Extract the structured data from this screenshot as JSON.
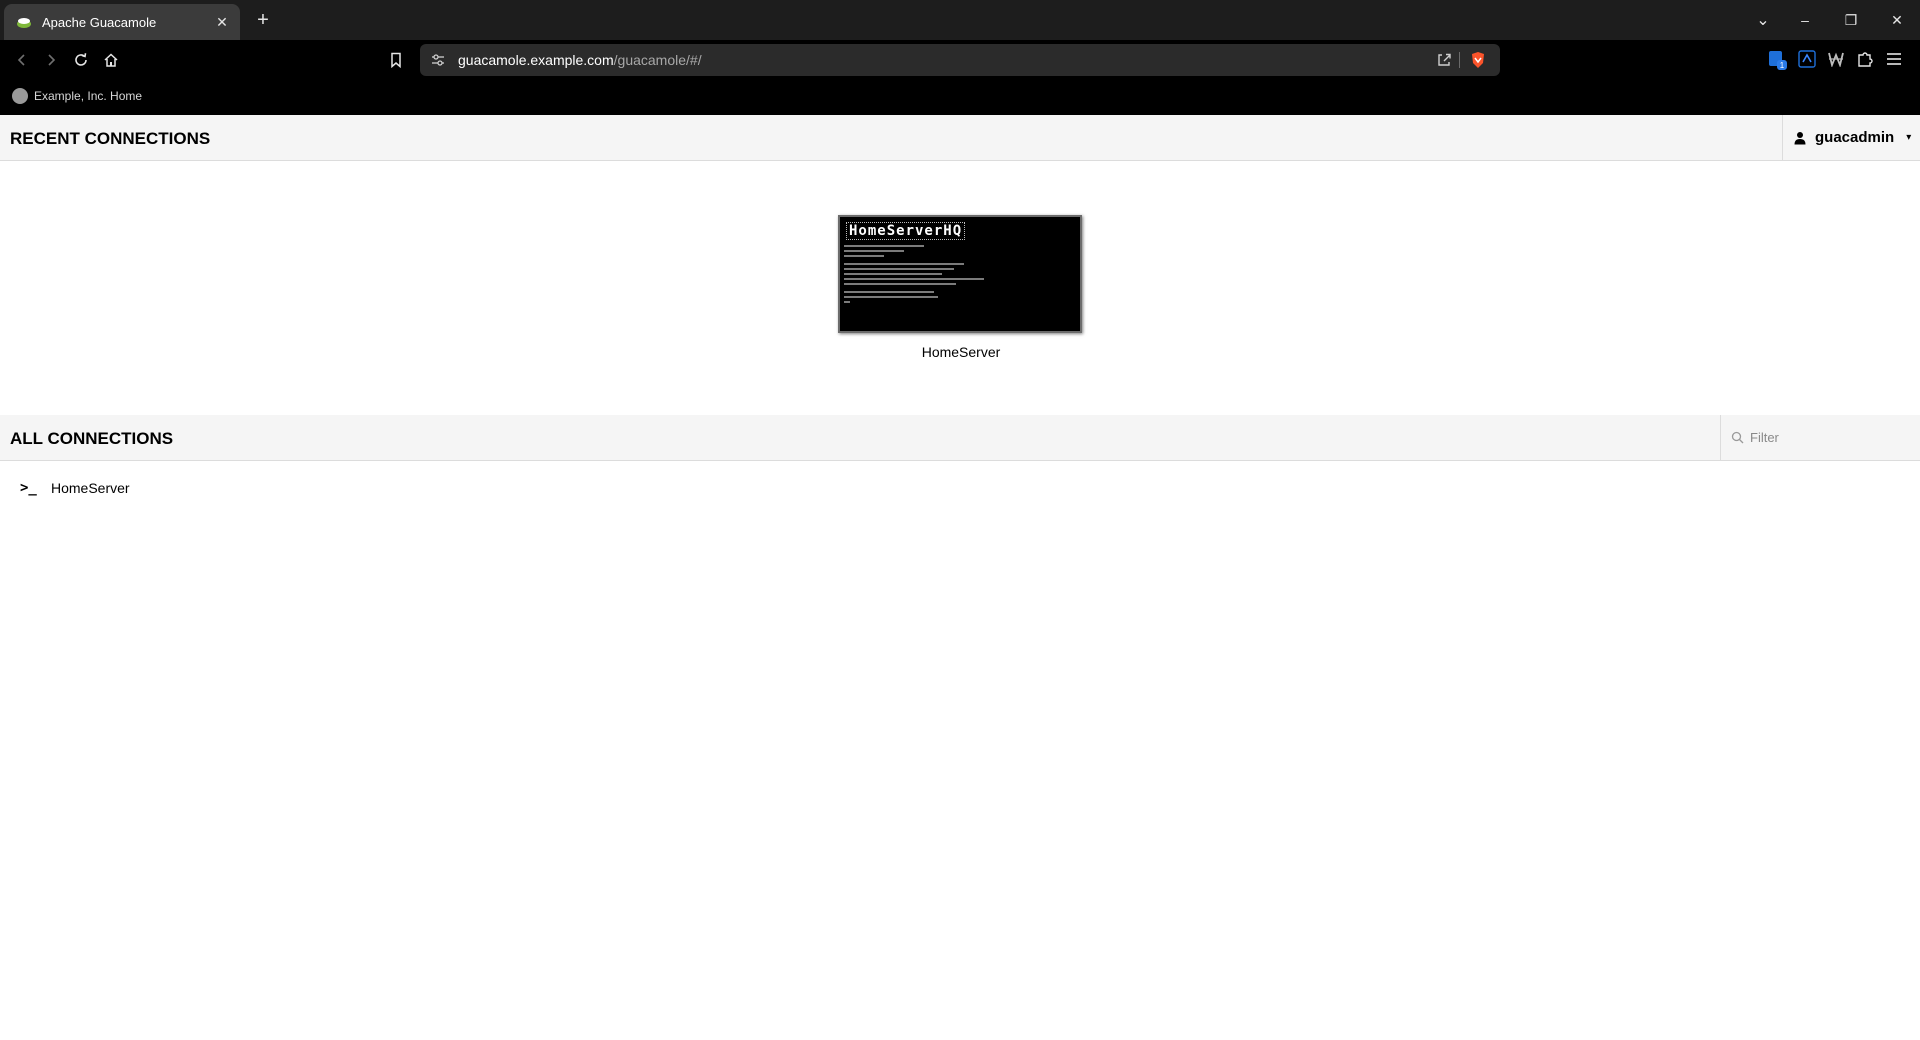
{
  "browser": {
    "tab": {
      "title": "Apache Guacamole"
    },
    "new_tab_symbol": "+",
    "window_controls": {
      "tab_search": "⌄",
      "minimize": "–",
      "restore": "❐",
      "close": "✕"
    },
    "address": {
      "host": "guacamole.example.com",
      "path": "/guacamole/#/"
    },
    "bookmarks": [
      {
        "label": "Example, Inc. Home"
      }
    ],
    "icons": {
      "back": "chevron-left-icon",
      "forward": "chevron-right-icon",
      "reload": "reload-icon",
      "home": "home-icon",
      "bookmark": "bookmark-icon",
      "site-info": "tune-icon",
      "share": "share-icon",
      "shields": "brave-shield-icon",
      "extensions": "puzzle-icon",
      "menu": "hamburger-menu-icon"
    },
    "colors": {
      "brave_orange": "#fb542b",
      "extension_blue": "#1e6fd9"
    }
  },
  "app": {
    "recent": {
      "heading": "RECENT CONNECTIONS",
      "items": [
        {
          "name": "HomeServer",
          "thumbnail_title": "HomeServerHQ"
        }
      ]
    },
    "all": {
      "heading": "ALL CONNECTIONS",
      "filter_placeholder": "Filter",
      "connections": [
        {
          "name": "HomeServer",
          "icon": ">_"
        }
      ]
    },
    "user": {
      "name": "guacadmin",
      "caret": "▾"
    }
  }
}
